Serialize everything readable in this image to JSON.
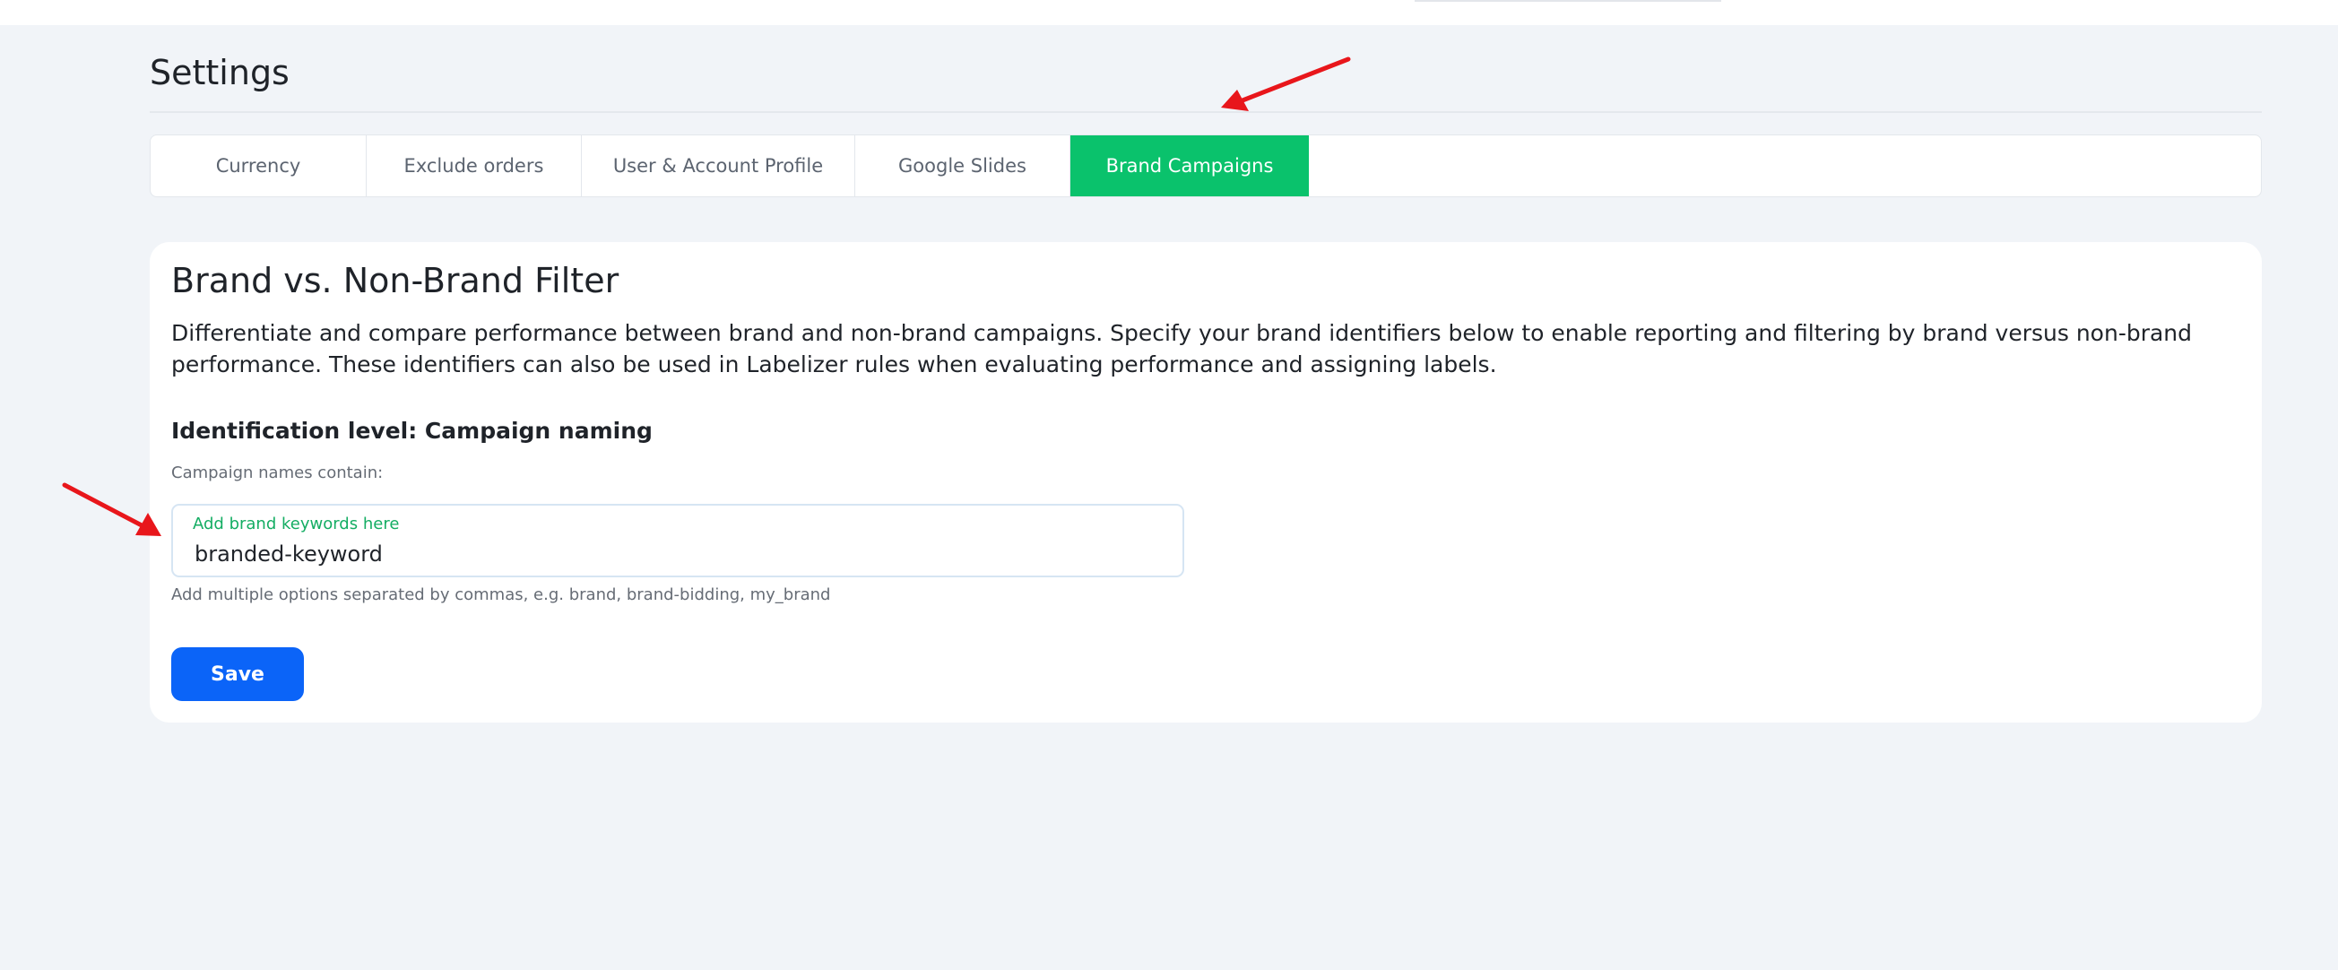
{
  "page": {
    "title": "Settings"
  },
  "tabs": [
    {
      "label": "Currency"
    },
    {
      "label": "Exclude orders"
    },
    {
      "label": "User & Account Profile"
    },
    {
      "label": "Google Slides"
    },
    {
      "label": "Brand Campaigns",
      "active": true
    }
  ],
  "brand_filter": {
    "title": "Brand vs. Non-Brand Filter",
    "description": "Differentiate and compare performance between brand and non-brand campaigns. Specify your brand identifiers below to enable reporting and filtering by brand versus non-brand performance. These identifiers can also be used in Labelizer rules when evaluating performance and assigning labels.",
    "identification_heading": "Identification level: Campaign naming",
    "field_label": "Campaign names contain:",
    "input_label": "Add brand keywords here",
    "input_value": "branded-keyword",
    "helper_text": "Add multiple options separated by commas, e.g. brand, brand-bidding, my_brand",
    "save_label": "Save"
  },
  "annotations": {
    "arrow_color": "#e8161b"
  },
  "colors": {
    "active_tab": "#0ac26c",
    "save_button": "#0b64f8",
    "input_label": "#14ad63",
    "background": "#f1f4f8"
  }
}
